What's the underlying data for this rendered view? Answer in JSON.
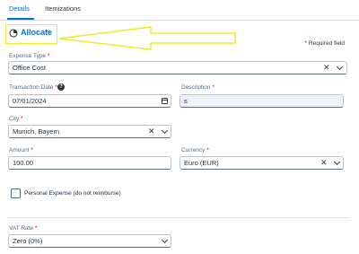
{
  "tabs": [
    {
      "label": "Details"
    },
    {
      "label": "Itemizations"
    }
  ],
  "allocate": {
    "label": "Allocate",
    "icon": "allocate-icon"
  },
  "required_note": {
    "star": "*",
    "text": "Required field"
  },
  "fields": {
    "expense_type": {
      "label": "Expense Type",
      "value": "Office Cost"
    },
    "transaction_date": {
      "label": "Transaction Date",
      "value": "07/01/2024"
    },
    "description": {
      "label": "Description",
      "value": "s"
    },
    "city": {
      "label": "City",
      "value": "Munich, Bayern"
    },
    "amount": {
      "label": "Amount",
      "value": "100.00"
    },
    "currency": {
      "label": "Currency",
      "value": "Euro (EUR)"
    },
    "personal_expense": {
      "label": "Personal Expense (do not reimburse)",
      "checked": false
    },
    "vat_rate": {
      "label": "VAT Rate",
      "value": "Zero (0%)"
    }
  },
  "colors": {
    "accent": "#0a6ed1",
    "annotation": "#f3e92b",
    "required": "#bb0000"
  }
}
